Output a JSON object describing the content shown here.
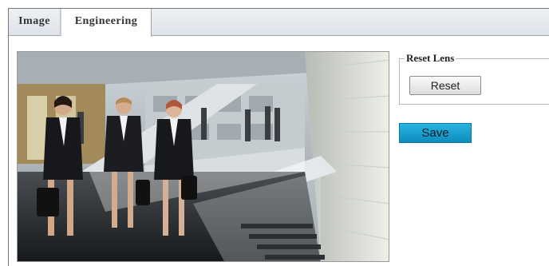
{
  "tabs": [
    {
      "label": "Image"
    },
    {
      "label": "Engineering"
    }
  ],
  "active_tab": "Engineering",
  "reset_lens": {
    "legend": "Reset Lens",
    "button_label": "Reset"
  },
  "save": {
    "button_label": "Save"
  },
  "colors": {
    "save_button": "#1a9fd0",
    "tab_bar": "#e3e8ed"
  }
}
